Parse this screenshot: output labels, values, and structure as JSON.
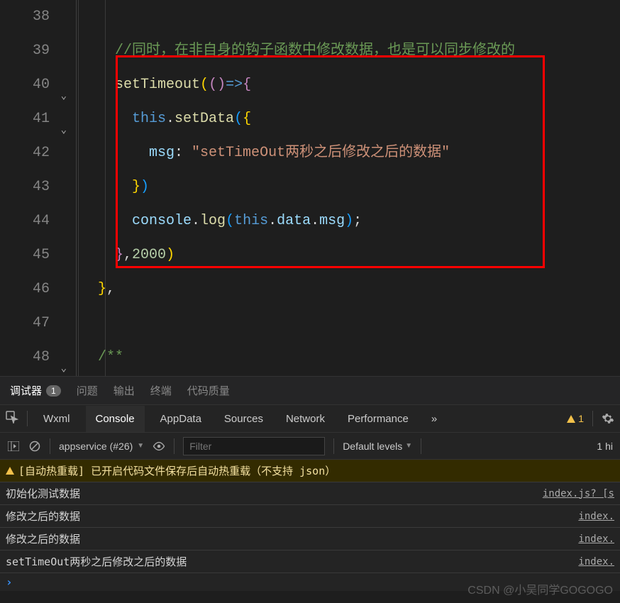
{
  "gutter": {
    "lines": [
      "38",
      "39",
      "40",
      "41",
      "42",
      "43",
      "44",
      "45",
      "46",
      "47",
      "48",
      ""
    ],
    "fold_at": [
      "40",
      "41",
      "48"
    ]
  },
  "code": {
    "l39_comment": "//同时，在非自身的钩子函数中修改数据，也是可以同步修改的",
    "l40_fn": "setTimeout",
    "l41_this": "this",
    "l41_fn": "setData",
    "l42_key": "msg",
    "l42_str": "\"setTimeOut两秒之后修改之后的数据\"",
    "l44_obj": "console",
    "l44_fn": "log",
    "l44_this": "this",
    "l44_data": "data",
    "l44_msg": "msg",
    "l45_num": "2000",
    "l48_comment": "/**"
  },
  "panel": {
    "debugger": "调试器",
    "badge": "1",
    "issues": "问题",
    "output": "输出",
    "terminal": "终端",
    "codequality": "代码质量"
  },
  "devtabs": {
    "wxml": "Wxml",
    "console": "Console",
    "appdata": "AppData",
    "sources": "Sources",
    "network": "Network",
    "performance": "Performance",
    "more": "»",
    "warn_count": "1"
  },
  "toolbar": {
    "context": "appservice (#26)",
    "filter_placeholder": "Filter",
    "levels": "Default levels",
    "hidden": "1 hi"
  },
  "console": {
    "rows": [
      {
        "type": "warn",
        "text": "[自动热重载] 已开启代码文件保存后自动热重载（不支持 json）",
        "src": ""
      },
      {
        "type": "log",
        "text": "初始化测试数据",
        "src": "index.js? [s"
      },
      {
        "type": "log",
        "text": "修改之后的数据",
        "src": "index."
      },
      {
        "type": "log",
        "text": "修改之后的数据",
        "src": "index."
      },
      {
        "type": "log",
        "text": "setTimeOut两秒之后修改之后的数据",
        "src": "index."
      }
    ]
  },
  "watermark": "CSDN @小吴同学GOGOGO"
}
